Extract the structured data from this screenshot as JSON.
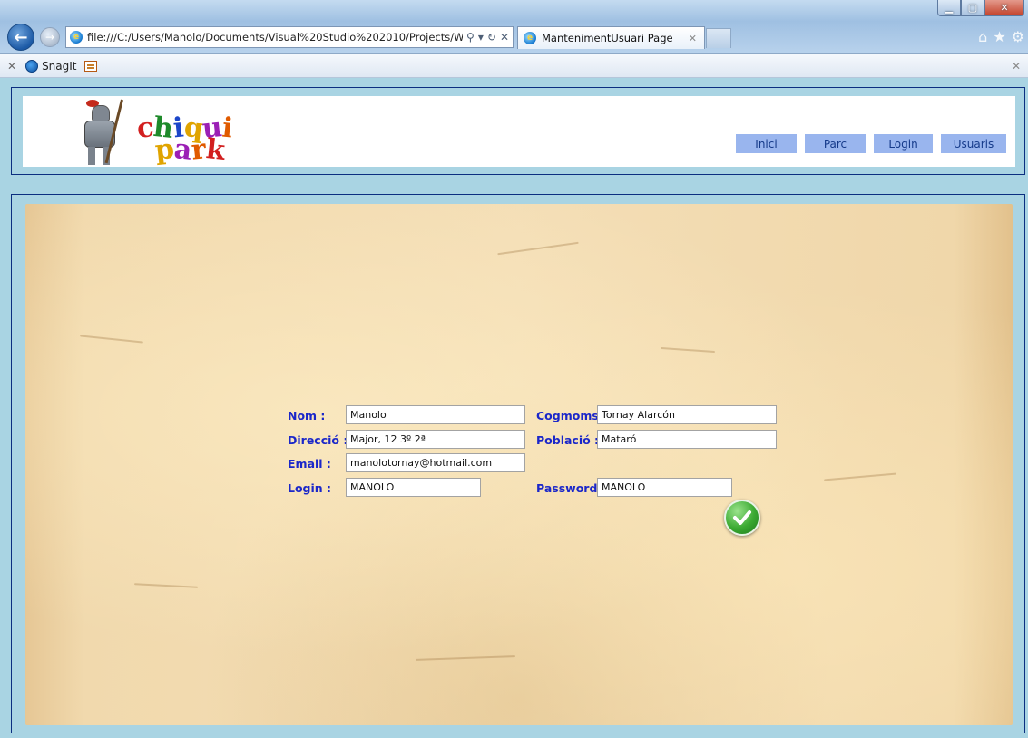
{
  "browser": {
    "address": "file:///C:/Users/Manolo/Documents/Visual%20Studio%202010/Projects/Web",
    "tab_title": "MantenimentUsuari Page",
    "toolbar_item": "SnagIt"
  },
  "site": {
    "logo_line1": [
      "c",
      "h",
      "i",
      "q",
      "u",
      "i"
    ],
    "logo_line2": [
      "p",
      "a",
      "r",
      "k"
    ],
    "logo_colors": [
      "#d21f1f",
      "#1e8a2a",
      "#1c46c9",
      "#e0a400",
      "#9b1fb5",
      "#e05a00"
    ],
    "menu": [
      "Inici",
      "Parc",
      "Login",
      "Usuaris"
    ]
  },
  "form": {
    "nom_label": "Nom :",
    "nom_value": "Manolo",
    "cognoms_label": "Cogmoms",
    "cognoms_value": "Tornay Alarcón",
    "direccio_label": "Direcció :",
    "direccio_value": "Major, 12 3º 2ª",
    "poblacio_label": "Població :",
    "poblacio_value": "Mataró",
    "email_label": "Email :",
    "email_value": "manolotornay@hotmail.com",
    "login_label": "Login :",
    "login_value": "MANOLO",
    "password_label": "Password",
    "password_value": "MANOLO"
  },
  "colors": {
    "label": "#1b27c9",
    "menu_bg": "#99b5ee",
    "page_bg": "#a9d4e3",
    "frame_border": "#0b2e80"
  }
}
